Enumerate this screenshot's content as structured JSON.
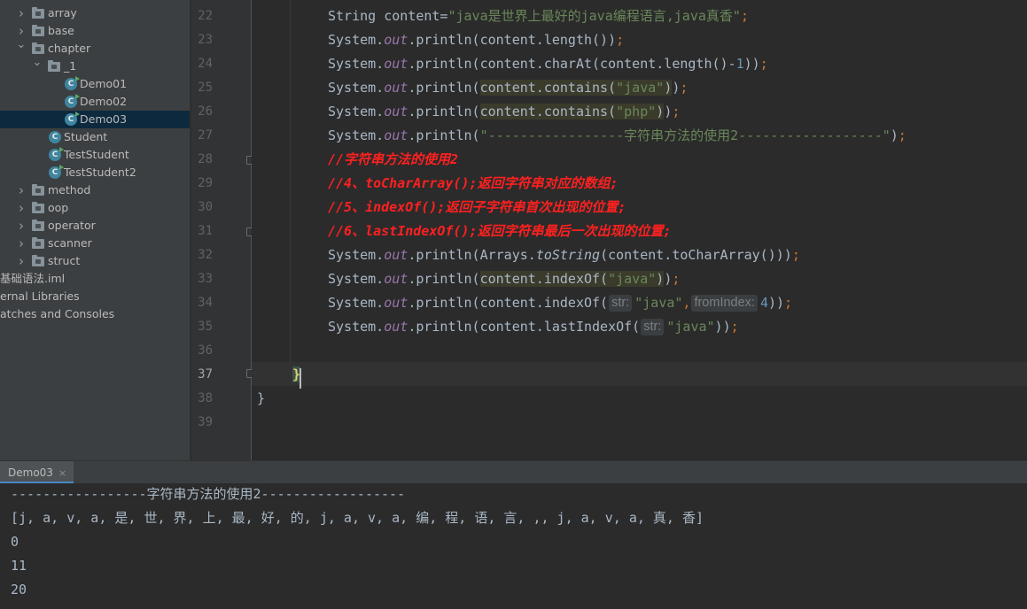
{
  "project_tree": [
    {
      "label": "array",
      "kind": "folder",
      "expanded": false
    },
    {
      "label": "base",
      "kind": "folder",
      "expanded": false
    },
    {
      "label": "chapter",
      "kind": "folder",
      "expanded": true
    },
    {
      "label": "_1",
      "kind": "folder",
      "expanded": true
    },
    {
      "label": "Demo01",
      "kind": "class-run"
    },
    {
      "label": "Demo02",
      "kind": "class-run"
    },
    {
      "label": "Demo03",
      "kind": "class-run",
      "selected": true
    },
    {
      "label": "Student",
      "kind": "class"
    },
    {
      "label": "TestStudent",
      "kind": "class-run"
    },
    {
      "label": "TestStudent2",
      "kind": "class-run"
    },
    {
      "label": "method",
      "kind": "folder",
      "expanded": false
    },
    {
      "label": "oop",
      "kind": "folder",
      "expanded": false
    },
    {
      "label": "operator",
      "kind": "folder",
      "expanded": false
    },
    {
      "label": "scanner",
      "kind": "folder",
      "expanded": false
    },
    {
      "label": "struct",
      "kind": "folder",
      "expanded": false
    },
    {
      "label": "基础语法.iml",
      "kind": "file"
    },
    {
      "label": "ernal Libraries",
      "kind": "libs"
    },
    {
      "label": "atches and Consoles",
      "kind": "scratches"
    }
  ],
  "editor": {
    "line_numbers": [
      "22",
      "23",
      "24",
      "25",
      "26",
      "27",
      "28",
      "29",
      "30",
      "31",
      "32",
      "33",
      "34",
      "35",
      "36",
      "37",
      "38",
      "39"
    ],
    "current_line": "37",
    "code_lines": [
      [
        {
          "t": "String content=",
          "c": "plain"
        },
        {
          "t": "\"java是世界上最好的java编程语言,java真香\"",
          "c": "str"
        },
        {
          "t": ";",
          "c": "kw"
        }
      ],
      [
        {
          "t": "System.",
          "c": "plain"
        },
        {
          "t": "out",
          "c": "field"
        },
        {
          "t": ".println(content.length())",
          "c": "plain"
        },
        {
          "t": ";",
          "c": "kw"
        }
      ],
      [
        {
          "t": "System.",
          "c": "plain"
        },
        {
          "t": "out",
          "c": "field"
        },
        {
          "t": ".println(content.charAt(content.length()-",
          "c": "plain"
        },
        {
          "t": "1",
          "c": "num"
        },
        {
          "t": "))",
          "c": "plain"
        },
        {
          "t": ";",
          "c": "kw"
        }
      ],
      [
        {
          "t": "System.",
          "c": "plain"
        },
        {
          "t": "out",
          "c": "field"
        },
        {
          "t": ".println(",
          "c": "plain"
        },
        {
          "t": "content.contains(",
          "c": "plain",
          "hl": true
        },
        {
          "t": "\"java\"",
          "c": "str",
          "hl": true
        },
        {
          "t": ")",
          "c": "plain",
          "hl": true
        },
        {
          "t": ")",
          "c": "plain"
        },
        {
          "t": ";",
          "c": "kw"
        }
      ],
      [
        {
          "t": "System.",
          "c": "plain"
        },
        {
          "t": "out",
          "c": "field"
        },
        {
          "t": ".println(",
          "c": "plain"
        },
        {
          "t": "content.contains(",
          "c": "plain",
          "hl": true
        },
        {
          "t": "\"php\"",
          "c": "str",
          "hl": true
        },
        {
          "t": ")",
          "c": "plain",
          "hl": true
        },
        {
          "t": ")",
          "c": "plain"
        },
        {
          "t": ";",
          "c": "kw"
        }
      ],
      [
        {
          "t": "System.",
          "c": "plain"
        },
        {
          "t": "out",
          "c": "field"
        },
        {
          "t": ".println(",
          "c": "plain"
        },
        {
          "t": "\"-----------------字符串方法的使用2------------------\"",
          "c": "str"
        },
        {
          "t": ")",
          "c": "plain"
        },
        {
          "t": ";",
          "c": "kw"
        }
      ],
      [
        {
          "t": "//字符串方法的使用2",
          "c": "comment"
        }
      ],
      [
        {
          "t": "//4、toCharArray();返回字符串对应的数组;",
          "c": "comment"
        }
      ],
      [
        {
          "t": "//5、indexOf();返回子字符串首次出现的位置;",
          "c": "comment"
        }
      ],
      [
        {
          "t": "//6、lastIndexOf();返回字符串最后一次出现的位置;",
          "c": "comment"
        }
      ],
      [
        {
          "t": "System.",
          "c": "plain"
        },
        {
          "t": "out",
          "c": "field"
        },
        {
          "t": ".println(Arrays.",
          "c": "plain"
        },
        {
          "t": "toString",
          "c": "static"
        },
        {
          "t": "(content.toCharArray()))",
          "c": "plain"
        },
        {
          "t": ";",
          "c": "kw"
        }
      ],
      [
        {
          "t": "System.",
          "c": "plain"
        },
        {
          "t": "out",
          "c": "field"
        },
        {
          "t": ".println(",
          "c": "plain"
        },
        {
          "t": "content.indexOf(",
          "c": "plain",
          "hl": true
        },
        {
          "t": "\"java\"",
          "c": "str",
          "hl": true
        },
        {
          "t": ")",
          "c": "plain",
          "hl": true
        },
        {
          "t": ")",
          "c": "plain"
        },
        {
          "t": ";",
          "c": "kw"
        }
      ],
      [
        {
          "t": "System.",
          "c": "plain"
        },
        {
          "t": "out",
          "c": "field"
        },
        {
          "t": ".println(content.indexOf(",
          "c": "plain"
        },
        {
          "t": "str:",
          "c": "hint"
        },
        {
          "t": "\"java\"",
          "c": "str"
        },
        {
          "t": ",",
          "c": "kw"
        },
        {
          "t": "fromIndex:",
          "c": "hint"
        },
        {
          "t": "4",
          "c": "num"
        },
        {
          "t": "))",
          "c": "plain"
        },
        {
          "t": ";",
          "c": "kw"
        }
      ],
      [
        {
          "t": "System.",
          "c": "plain"
        },
        {
          "t": "out",
          "c": "field"
        },
        {
          "t": ".println(content.lastIndexOf(",
          "c": "plain"
        },
        {
          "t": "str:",
          "c": "hint"
        },
        {
          "t": "\"java\"",
          "c": "str"
        },
        {
          "t": "))",
          "c": "plain"
        },
        {
          "t": ";",
          "c": "kw"
        }
      ],
      [],
      [
        {
          "t": "}",
          "c": "caret"
        }
      ],
      [
        {
          "t": "}",
          "c": "plain"
        }
      ],
      []
    ]
  },
  "run_panel": {
    "tab_label": "Demo03",
    "close_glyph": "×",
    "output_lines": [
      "-----------------字符串方法的使用2------------------",
      "[j, a, v, a, 是, 世, 界, 上, 最, 好, 的, j, a, v, a, 编, 程, 语, 言, ,, j, a, v, a, 真, 香]",
      "0",
      "11",
      "20"
    ]
  },
  "colors": {
    "editor_bg": "#2b2b2b",
    "tree_bg": "#3c3f41",
    "gutter_bg": "#313335",
    "selection_bg": "#0d293e",
    "string": "#6a8759",
    "keyword": "#cc7832",
    "field": "#9876aa",
    "number": "#6897bb",
    "comment_custom": "#ff2020"
  }
}
